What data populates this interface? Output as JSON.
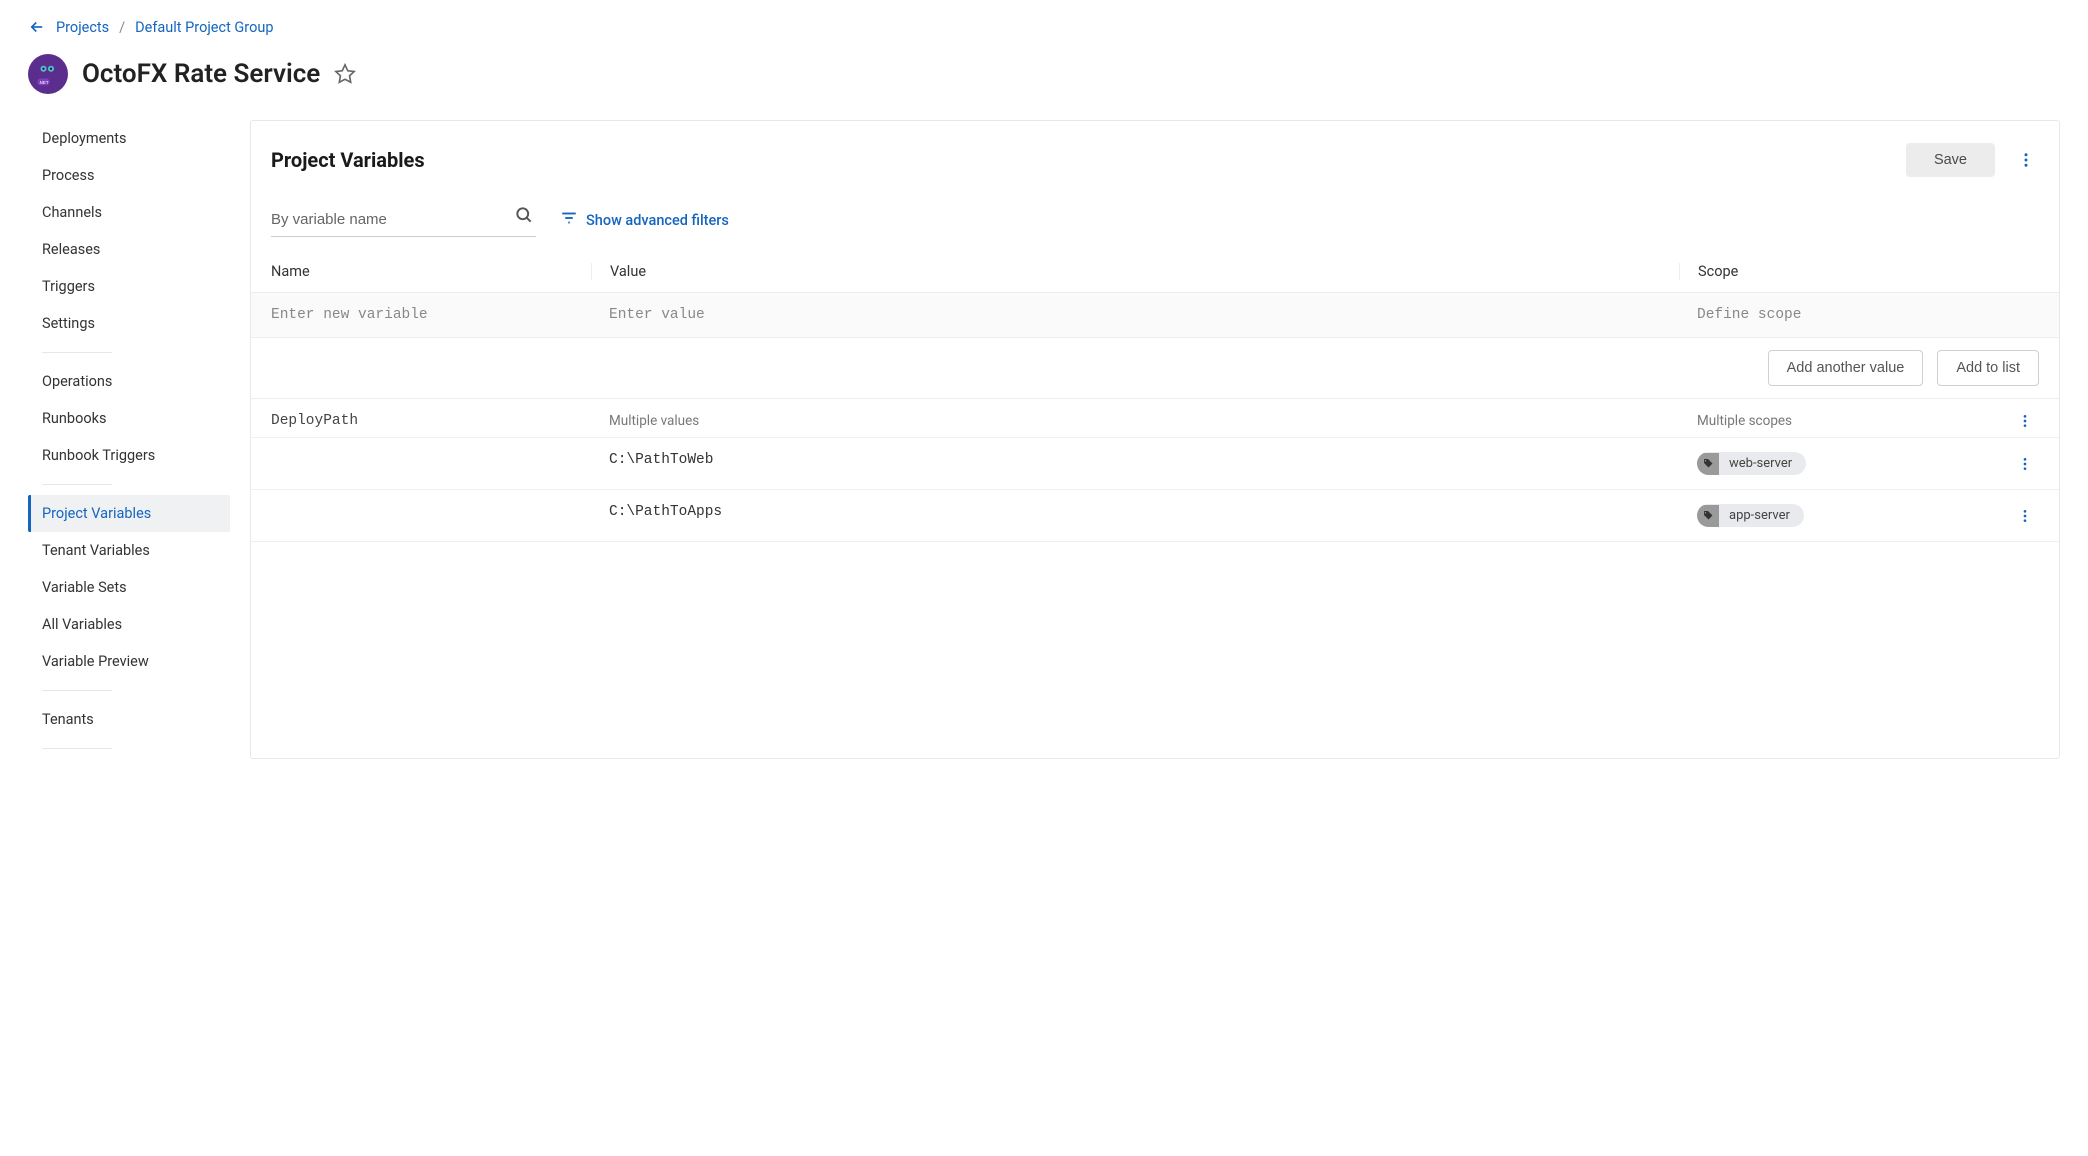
{
  "breadcrumb": {
    "projects_label": "Projects",
    "group_label": "Default Project Group"
  },
  "project": {
    "title": "OctoFX Rate Service"
  },
  "sidebar": {
    "items": [
      {
        "label": "Deployments"
      },
      {
        "label": "Process"
      },
      {
        "label": "Channels"
      },
      {
        "label": "Releases"
      },
      {
        "label": "Triggers"
      },
      {
        "label": "Settings"
      },
      {
        "label": "Operations"
      },
      {
        "label": "Runbooks"
      },
      {
        "label": "Runbook Triggers"
      },
      {
        "label": "Project Variables"
      },
      {
        "label": "Tenant Variables"
      },
      {
        "label": "Variable Sets"
      },
      {
        "label": "All Variables"
      },
      {
        "label": "Variable Preview"
      },
      {
        "label": "Tenants"
      }
    ]
  },
  "main": {
    "title": "Project Variables",
    "save_label": "Save",
    "search_placeholder": "By variable name",
    "advanced_filters_label": "Show advanced filters",
    "columns": {
      "name": "Name",
      "value": "Value",
      "scope": "Scope"
    },
    "new_row": {
      "name_placeholder": "Enter new variable",
      "value_placeholder": "Enter value",
      "scope_placeholder": "Define scope"
    },
    "actions": {
      "add_another_value": "Add another value",
      "add_to_list": "Add to list"
    },
    "variable": {
      "name": "DeployPath",
      "header": {
        "value_label": "Multiple values",
        "scope_label": "Multiple scopes"
      },
      "rows": [
        {
          "value": "C:\\PathToWeb",
          "scope": "web-server"
        },
        {
          "value": "C:\\PathToApps",
          "scope": "app-server"
        }
      ]
    }
  }
}
